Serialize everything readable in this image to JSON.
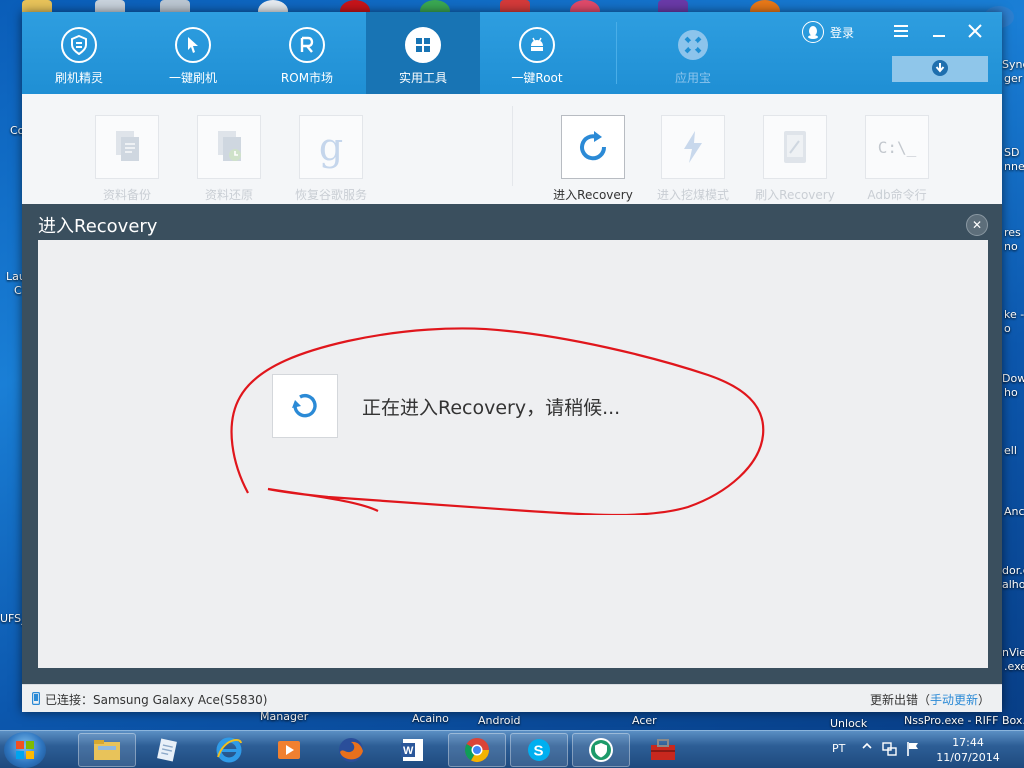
{
  "app": {
    "nav": [
      {
        "label": "刷机精灵",
        "icon": "shield-icon"
      },
      {
        "label": "一键刷机",
        "icon": "cursor-arrow-icon"
      },
      {
        "label": "ROM市场",
        "icon": "rom-r-icon"
      },
      {
        "label": "实用工具",
        "icon": "grid-icon"
      },
      {
        "label": "一键Root",
        "icon": "android-icon"
      },
      {
        "label": "应用宝",
        "icon": "appstore-icon"
      }
    ],
    "active_nav": "实用工具",
    "login_label": "登录",
    "tools": [
      {
        "label": "资料备份",
        "icon": "document-backup-icon"
      },
      {
        "label": "资料还原",
        "icon": "document-restore-icon"
      },
      {
        "label": "恢复谷歌服务",
        "icon": "google-g-icon"
      },
      {
        "label": "进入Recovery",
        "icon": "refresh-icon"
      },
      {
        "label": "进入挖煤模式",
        "icon": "lightning-icon"
      },
      {
        "label": "刷入Recovery",
        "icon": "phone-edit-icon"
      },
      {
        "label": "Adb命令行",
        "icon": "terminal-icon",
        "glyph": "C:\\_"
      }
    ],
    "active_tool": "进入Recovery",
    "dialog": {
      "title": "进入Recovery",
      "message": "正在进入Recovery，请稍候..."
    },
    "status": {
      "connected_prefix": "已连接：",
      "device": "Samsung Galaxy Ace(S5830)",
      "update_text": "更新出错（",
      "update_link": "手动更新",
      "update_suffix": "）"
    },
    "colors": {
      "accent": "#1f8fd4",
      "annotation": "#e0161c",
      "link": "#2b8ad6"
    }
  },
  "desktop": {
    "right_fragments": [
      "Sync",
      "ger",
      "SD",
      "nnec",
      "res -",
      "no",
      "ke -",
      "o",
      "Down",
      "ho",
      "ell",
      "Anc",
      "dor.c",
      "alho",
      "nVie",
      ".exe"
    ],
    "left_fragments": [
      "Co",
      "Lau",
      "C",
      "UFS_"
    ],
    "bottom_labels": [
      "Manager",
      "Acaino",
      "Android",
      "Acer",
      "Unlock",
      "NssPro.exe - RIFF Box..."
    ]
  },
  "taskbar": {
    "apps": [
      "file-explorer-icon",
      "notepad-icon",
      "ie-icon",
      "media-player-icon",
      "firefox-icon",
      "word-icon",
      "chrome-icon",
      "skype-icon",
      "shuajijingling-icon",
      "toolbox-icon"
    ],
    "lang": "PT",
    "time": "17:44",
    "date": "11/07/2014"
  }
}
